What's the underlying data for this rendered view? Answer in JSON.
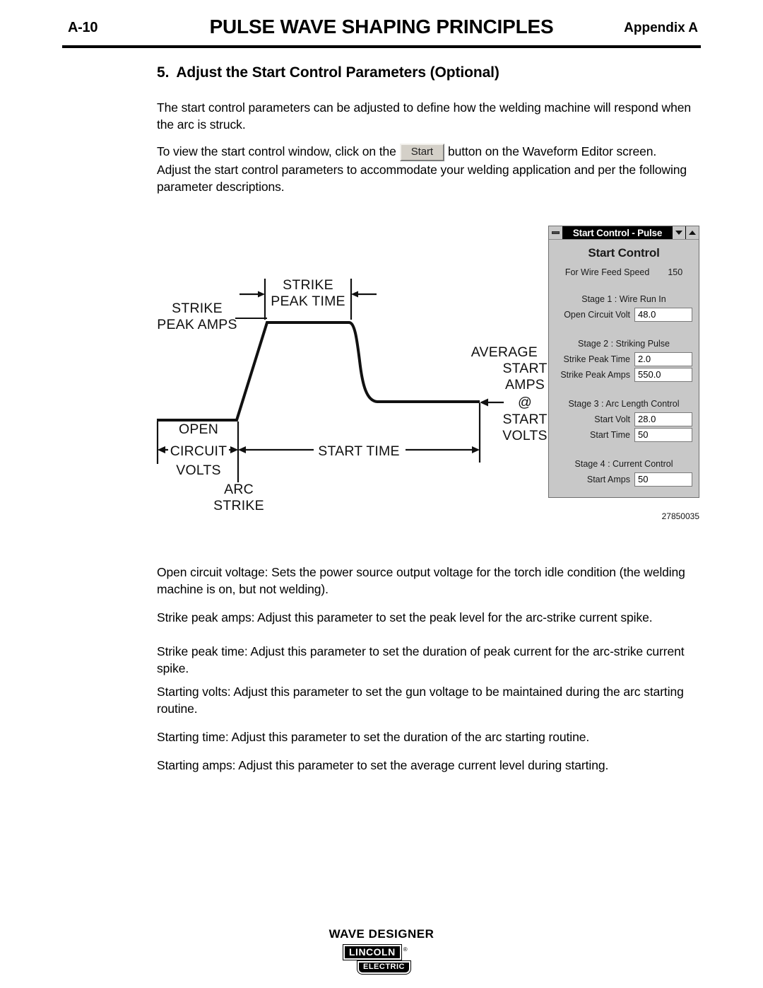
{
  "header": {
    "page_number": "A-10",
    "title": "PULSE WAVE SHAPING PRINCIPLES",
    "appendix": "Appendix A"
  },
  "section": {
    "number": "5.",
    "heading": "Adjust the Start Control Parameters (Optional)"
  },
  "intro": {
    "paragraph1": "The start control parameters can be adjusted to define how the welding machine will respond when the arc is struck.",
    "paragraph2_before": "To view the start control window, click on the",
    "start_button_label": "Start",
    "paragraph2_after": "button on the Waveform Editor screen. Adjust the start control parameters to accommodate your welding application and per the following parameter descriptions."
  },
  "diagram": {
    "labels": {
      "strike_peak_time": [
        "STRIKE",
        "PEAK TIME"
      ],
      "strike_peak_amps": [
        "STRIKE",
        "PEAK AMPS"
      ],
      "average_start": [
        "AVERAGE",
        "START",
        "AMPS",
        "@",
        "START",
        "VOLTS"
      ],
      "open_circuit_volts": [
        "OPEN",
        "CIRCUIT",
        "VOLTS"
      ],
      "start_time": "START TIME",
      "arc_strike": [
        "ARC",
        "STRIKE"
      ]
    }
  },
  "dialog": {
    "titlebar": {
      "title": "Start Control - Pulse",
      "minimize_icon": "minimize-icon",
      "down_icon": "chevron-down-icon",
      "up_icon": "chevron-up-icon"
    },
    "heading": "Start Control",
    "wire_feed_speed": {
      "label": "For Wire Feed Speed",
      "value": "150"
    },
    "stages": [
      {
        "title": "Stage 1 : Wire Run In",
        "fields": [
          {
            "label": "Open Circuit Volt",
            "value": "48.0"
          }
        ]
      },
      {
        "title": "Stage 2 : Striking Pulse",
        "fields": [
          {
            "label": "Strike Peak Time",
            "value": "2.0"
          },
          {
            "label": "Strike Peak Amps",
            "value": "550.0"
          }
        ]
      },
      {
        "title": "Stage 3 : Arc Length Control",
        "fields": [
          {
            "label": "Start Volt",
            "value": "28.0"
          },
          {
            "label": "Start Time",
            "value": "50"
          }
        ]
      },
      {
        "title": "Stage 4 : Current Control",
        "fields": [
          {
            "label": "Start Amps",
            "value": "50"
          }
        ]
      }
    ],
    "part_number": "27850035"
  },
  "descriptions": {
    "d1": "Open circuit voltage:  Sets the power source output voltage for the torch idle condition (the welding machine is on, but not welding).",
    "d2": "Strike peak amps:  Adjust this parameter to set the peak level for the arc-strike current spike.",
    "d3": "Strike peak time:  Adjust this parameter to set the duration of peak current for the arc-strike current spike.",
    "d4": "Starting volts:  Adjust this parameter to set the gun voltage to be maintained during the arc starting routine.",
    "d5": "Starting time:  Adjust this parameter to set the duration of the arc starting routine.",
    "d6": "Starting amps:  Adjust this parameter to set the average current level during starting."
  },
  "footer": {
    "title": "WAVE  DESIGNER",
    "logo_line1": "LINCOLN",
    "logo_registered": "®",
    "logo_line2": "ELECTRIC"
  },
  "colors": {
    "dialog_bg": "#c8c8c8",
    "titlebar_bg": "#000000",
    "input_bg": "#ffffff",
    "button_face": "#d4d0c8"
  }
}
